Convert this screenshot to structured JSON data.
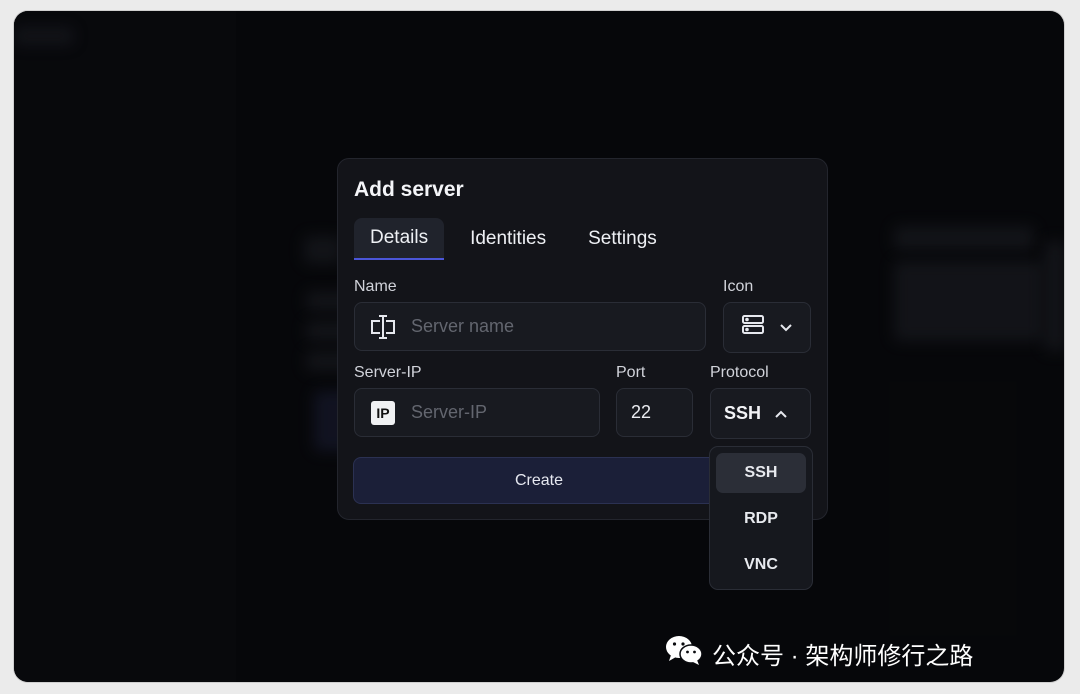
{
  "dialog": {
    "title": "Add server",
    "tabs": [
      {
        "label": "Details",
        "active": true
      },
      {
        "label": "Identities",
        "active": false
      },
      {
        "label": "Settings",
        "active": false
      }
    ],
    "name": {
      "label": "Name",
      "placeholder": "Server name",
      "icon": "text-cursor-icon"
    },
    "icon_picker": {
      "label": "Icon",
      "icon": "server-icon"
    },
    "server_ip": {
      "label": "Server-IP",
      "placeholder": "Server-IP",
      "icon": "ip-icon"
    },
    "port": {
      "label": "Port",
      "value": "22"
    },
    "protocol": {
      "label": "Protocol",
      "value": "SSH",
      "options": [
        "SSH",
        "RDP",
        "VNC"
      ],
      "expanded": true
    },
    "create_label": "Create"
  },
  "watermark": {
    "text": "公众号 · 架构师修行之路",
    "icon": "wechat-icon"
  },
  "colors": {
    "accent": "#4b56d9",
    "dialog_bg": "#131419",
    "button_bg": "#1b1f38"
  }
}
